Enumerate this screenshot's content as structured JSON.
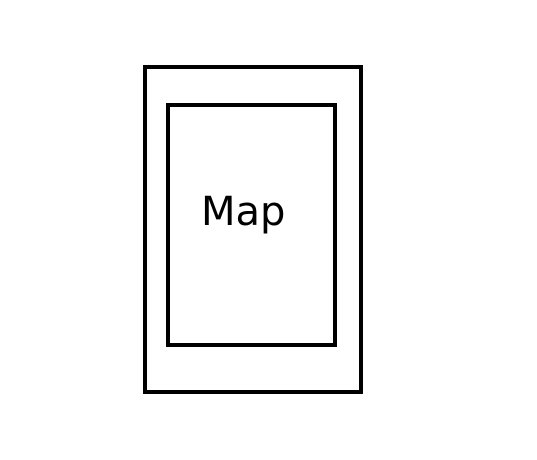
{
  "diagram": {
    "label": "Map",
    "stroke_color": "#000000",
    "background_color": "#ffffff"
  }
}
